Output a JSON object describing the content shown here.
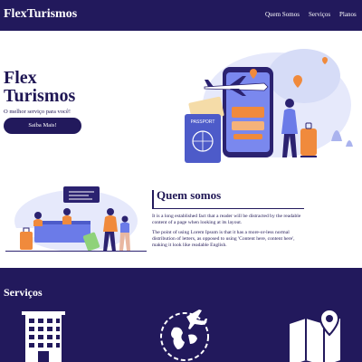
{
  "navbar": {
    "brand": "FlexTurismos",
    "links": [
      "Quem Somos",
      "Serviços",
      "Planos"
    ]
  },
  "hero": {
    "title_line1": "Flex",
    "title_line2": "Turismos",
    "subtitle": "O melhor serviço para você!",
    "button_label": "Saiba Mais!",
    "passport_label": "PASSPORT"
  },
  "about": {
    "title": "Quem somos",
    "paragraph1": "It is a long established fact that a reader will be distracted by the readable content of a page when looking at its layout.",
    "paragraph2": "The point of using Lorem Ipsum is that it has a more-or-less normal distribution of letters, as opposed to using 'Content here, content here', making it look like readable English."
  },
  "services": {
    "title": "Serviços",
    "icons": [
      "building-icon",
      "globe-airplane-icon",
      "map-pin-icon"
    ]
  },
  "colors": {
    "primary": "#22195c",
    "text": "#1f1654",
    "accent_orange": "#f08a3c",
    "accent_blue": "#6b7be8"
  }
}
